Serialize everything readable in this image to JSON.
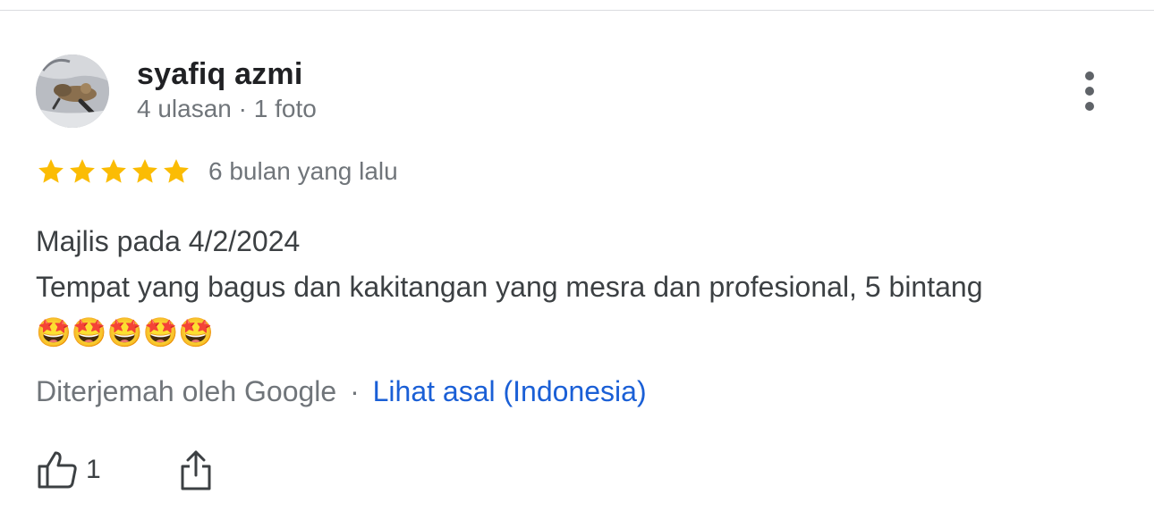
{
  "review": {
    "author": {
      "name": "syafiq azmi",
      "meta": "4 ulasan · 1 foto"
    },
    "rating": {
      "stars": 5,
      "max": 5,
      "color": "#fbbc04"
    },
    "time": "6 bulan yang lalu",
    "body": {
      "line1": "Majlis pada 4/2/2024",
      "line2": "Tempat yang bagus dan kakitangan yang mesra dan profesional, 5 bintang",
      "line3": "🤩🤩🤩🤩🤩"
    },
    "translation": {
      "translated_by": "Diterjemah oleh Google",
      "separator": "·",
      "see_original": "Lihat asal (Indonesia)"
    },
    "actions": {
      "like_count": "1"
    }
  },
  "icons": {
    "more": "more-vert-icon",
    "star": "star-icon",
    "like": "thumb-up-icon",
    "share": "share-icon"
  },
  "colors": {
    "link": "#1a5fd6",
    "secondary_text": "#70757a",
    "star": "#fbbc04"
  }
}
